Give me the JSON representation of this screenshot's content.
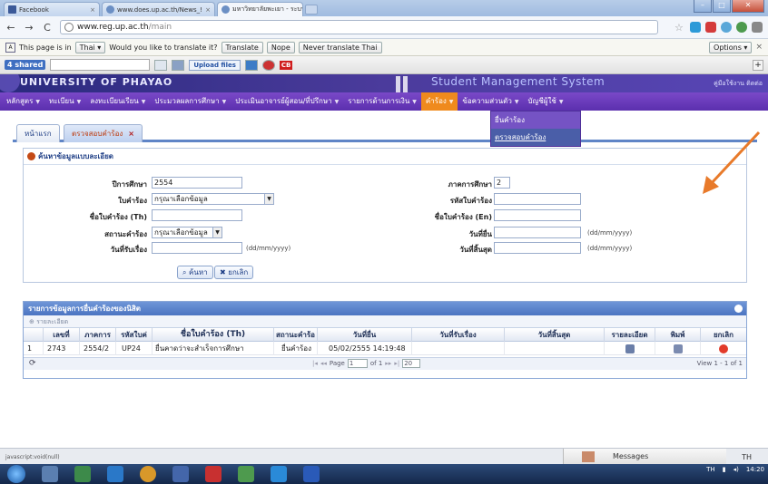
{
  "browser": {
    "tabs": [
      {
        "title": "Facebook"
      },
      {
        "title": "www.does.up.ac.th/News_!"
      },
      {
        "title": "มหาวิทยาลัยพะเยา - ระบบบริ"
      }
    ],
    "url_host": "www.reg.up.ac.th",
    "url_path": "/main"
  },
  "translate_bar": {
    "prefix": "This page is in",
    "language": "Thai",
    "question": "Would you like to translate it?",
    "translate": "Translate",
    "nope": "Nope",
    "never": "Never translate Thai",
    "options": "Options"
  },
  "toolbar": {
    "shared": "4 shared",
    "upload": "Upload files",
    "cb": "CB"
  },
  "site": {
    "university": "UNIVERSITY OF PHAYAO",
    "system": "Student Management System",
    "user": "คู่มือใช้งาน   ติดต่อ"
  },
  "menu": [
    {
      "label": "หลักสูตร"
    },
    {
      "label": "ทะเบียน"
    },
    {
      "label": "ลงทะเบียนเรียน"
    },
    {
      "label": "ประมวลผลการศึกษา"
    },
    {
      "label": "ประเมินอาจารย์ผู้สอน/ที่ปรึกษา"
    },
    {
      "label": "รายการด้านการเงิน"
    },
    {
      "label": "คำร้อง"
    },
    {
      "label": "ข้อความส่วนตัว"
    },
    {
      "label": "บัญชีผู้ใช้"
    }
  ],
  "dropdown": [
    {
      "label": "ยื่นคำร้อง"
    },
    {
      "label": "ตรวจสอบคำร้อง"
    }
  ],
  "subtabs": {
    "home": "หน้าแรก",
    "check": "ตรวจสอบคำร้อง",
    "close": "×"
  },
  "search": {
    "title": "ค้นหาข้อมูลแบบละเอียด",
    "year_label": "ปีการศึกษา",
    "year_value": "2554",
    "semester_label": "ภาคการศึกษา",
    "semester_value": "2",
    "form_label": "ใบคำร้อง",
    "form_value": "กรุณาเลือกข้อมูล",
    "code_label": "รหัสใบคำร้อง",
    "name_th_label": "ชื่อใบคำร้อง (Th)",
    "name_en_label": "ชื่อใบคำร้อง (En)",
    "status_label": "สถานะคำร้อง",
    "status_value": "กรุณาเลือกข้อมูล",
    "submit_date_label": "วันที่ยื่น",
    "receive_date_label": "วันที่รับเรื่อง",
    "end_date_label": "วันที่สิ้นสุด",
    "date_hint": "(dd/mm/yyyy)",
    "search_btn": "ค้นหา",
    "cancel_btn": "ยกเลิก"
  },
  "grid": {
    "title": "รายการข้อมูลการยื่นคำร้องของนิสิต",
    "detail_tool": "รายละเอียด",
    "columns": [
      "เลขที่",
      "ภาคการ",
      "รหัสใบค่",
      "ชื่อใบคำร้อง (Th)",
      "สถานะคำร้อ",
      "วันที่ยื่น",
      "วันที่รับเรื่อง",
      "วันที่สิ้นสุด",
      "รายละเอียด",
      "พิมพ์",
      "ยกเลิก"
    ],
    "rows": [
      {
        "idx": "1",
        "no": "2743",
        "term": "2554/2",
        "code": "UP24",
        "name": "ยื่นคาดว่าจะสำเร็จการศึกษา",
        "status": "ยื่นคำร้อง",
        "submitted": "05/02/2555 14:19:48",
        "received": "",
        "ended": ""
      }
    ],
    "pager": {
      "page_label": "Page",
      "page": "1",
      "of": "of 1",
      "rows": "20",
      "view": "View 1 - 1 of 1"
    }
  },
  "statusbar": {
    "status": "javascript:void(null)",
    "messages": "Messages",
    "lang": "TH"
  },
  "tray": {
    "lang": "TH",
    "time": "14:20"
  },
  "colors": {
    "menu_purple": "#6a3cbf",
    "menu_active": "#ef8a1d",
    "grid_header": "#5a80c8",
    "arrow": "#e87a2a"
  }
}
